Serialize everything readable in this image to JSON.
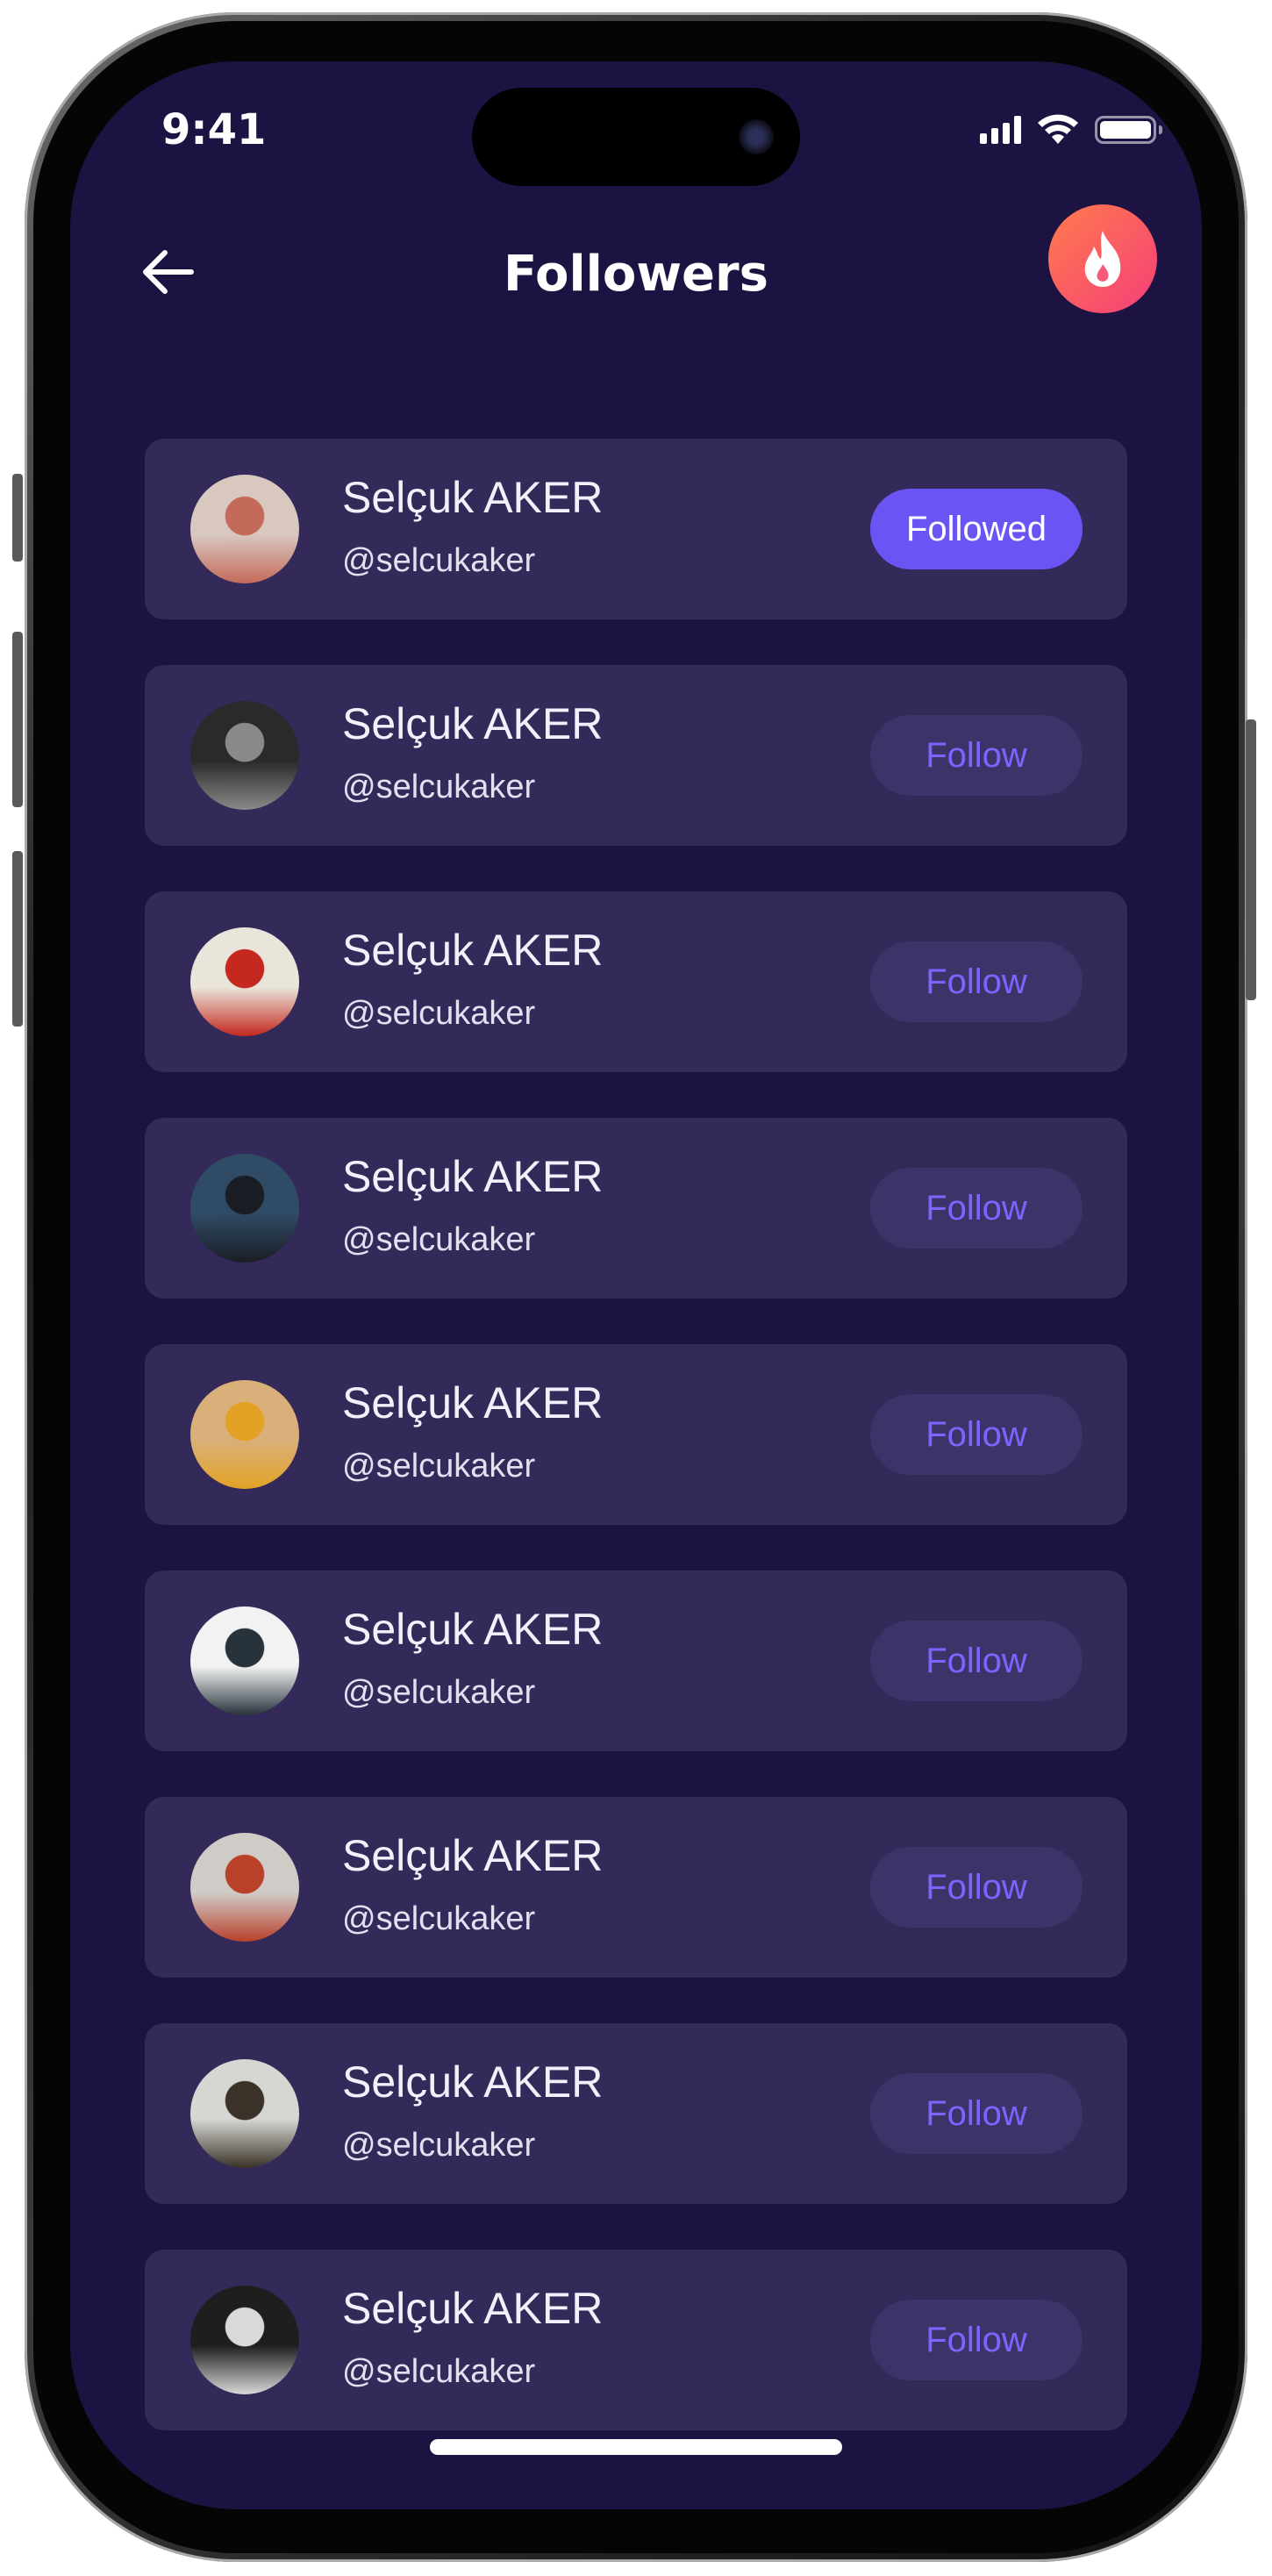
{
  "status_bar": {
    "time": "9:41"
  },
  "header": {
    "title": "Followers"
  },
  "colors": {
    "background": "#1d1342",
    "card": "#332a59",
    "follow_button": "#3c3468",
    "follow_text": "#7a66ff",
    "followed_button": "#6a55f4",
    "fire_gradient_start": "#ff7b4d",
    "fire_gradient_end": "#f53f78"
  },
  "followers": [
    {
      "name": "Selçuk AKER",
      "handle": "@selcukaker",
      "button": "Followed",
      "followed": true,
      "avatar_colors": [
        "#d8c8c0",
        "#c46a5a"
      ]
    },
    {
      "name": "Selçuk AKER",
      "handle": "@selcukaker",
      "button": "Follow",
      "followed": false,
      "avatar_colors": [
        "#2a2a2a",
        "#8a8a8a"
      ]
    },
    {
      "name": "Selçuk AKER",
      "handle": "@selcukaker",
      "button": "Follow",
      "followed": false,
      "avatar_colors": [
        "#e9e5da",
        "#c4281e"
      ]
    },
    {
      "name": "Selçuk AKER",
      "handle": "@selcukaker",
      "button": "Follow",
      "followed": false,
      "avatar_colors": [
        "#2f4b66",
        "#1b1d24"
      ]
    },
    {
      "name": "Selçuk AKER",
      "handle": "@selcukaker",
      "button": "Follow",
      "followed": false,
      "avatar_colors": [
        "#d9b07a",
        "#e3a225"
      ]
    },
    {
      "name": "Selçuk AKER",
      "handle": "@selcukaker",
      "button": "Follow",
      "followed": false,
      "avatar_colors": [
        "#f2f2f2",
        "#27323b"
      ]
    },
    {
      "name": "Selçuk AKER",
      "handle": "@selcukaker",
      "button": "Follow",
      "followed": false,
      "avatar_colors": [
        "#cfcbc7",
        "#b9412a"
      ]
    },
    {
      "name": "Selçuk AKER",
      "handle": "@selcukaker",
      "button": "Follow",
      "followed": false,
      "avatar_colors": [
        "#d6d6d2",
        "#3a3228"
      ]
    },
    {
      "name": "Selçuk AKER",
      "handle": "@selcukaker",
      "button": "Follow",
      "followed": false,
      "avatar_colors": [
        "#1e1e1e",
        "#d9d9d9"
      ]
    }
  ]
}
